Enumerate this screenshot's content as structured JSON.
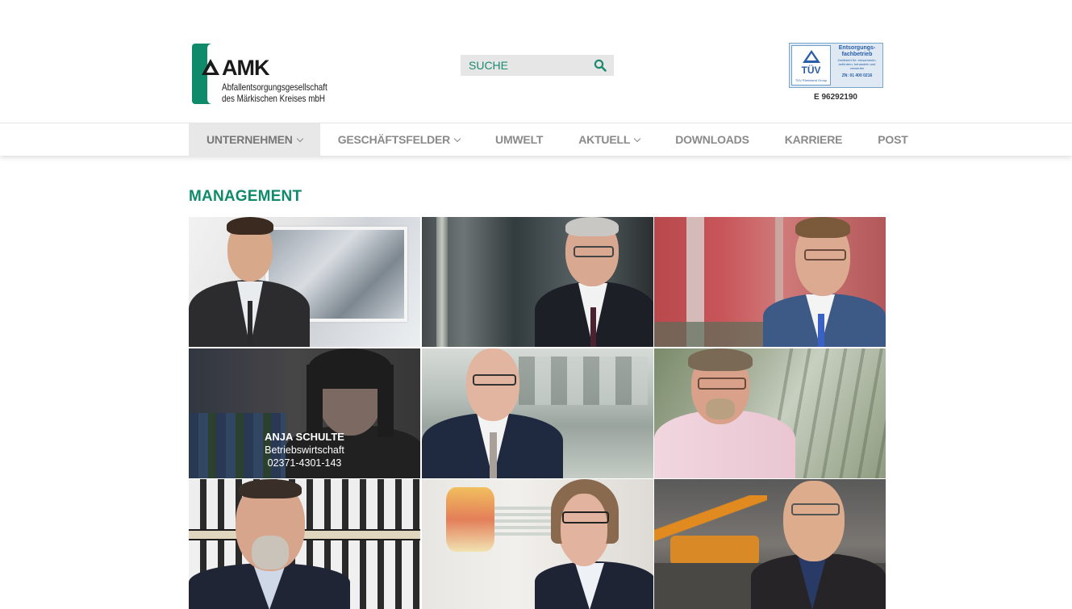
{
  "header": {
    "logo": {
      "name": "AMK",
      "subtitle_line1": "Abfallentsorgungsgesellschaft",
      "subtitle_line2": "des Märkischen Kreises mbH"
    },
    "search": {
      "placeholder": "SUCHE",
      "icon": "search-icon"
    },
    "certificate": {
      "brand": "TÜV",
      "group": "TÜV Rheinland Group",
      "title": "Entsorgungs-fachbetrieb",
      "text": "Zertifiziert für: einsammeln, befördern, behandeln und verwerten",
      "zn": "ZN: 01 400 0216",
      "code": "E 96292190"
    }
  },
  "nav": {
    "items": [
      {
        "label": "UNTERNEHMEN",
        "dropdown": true,
        "active": true
      },
      {
        "label": "GESCHÄFTSFELDER",
        "dropdown": true,
        "active": false
      },
      {
        "label": "UMWELT",
        "dropdown": false,
        "active": false
      },
      {
        "label": "AKTUELL",
        "dropdown": true,
        "active": false
      },
      {
        "label": "DOWNLOADS",
        "dropdown": false,
        "active": false
      },
      {
        "label": "KARRIERE",
        "dropdown": false,
        "active": false
      },
      {
        "label": "POST",
        "dropdown": false,
        "active": false
      }
    ]
  },
  "main": {
    "title": "MANAGEMENT",
    "hovered_person": {
      "name": "ANJA SCHULTE",
      "role": "Betriebswirtschaft",
      "phone": "02371-4301-143"
    }
  },
  "colors": {
    "brand_green": "#0f8a6a",
    "nav_active_bg": "#e8e8e8",
    "search_bg": "#e6e6e6",
    "tuv_blue": "#2a5ea6"
  }
}
